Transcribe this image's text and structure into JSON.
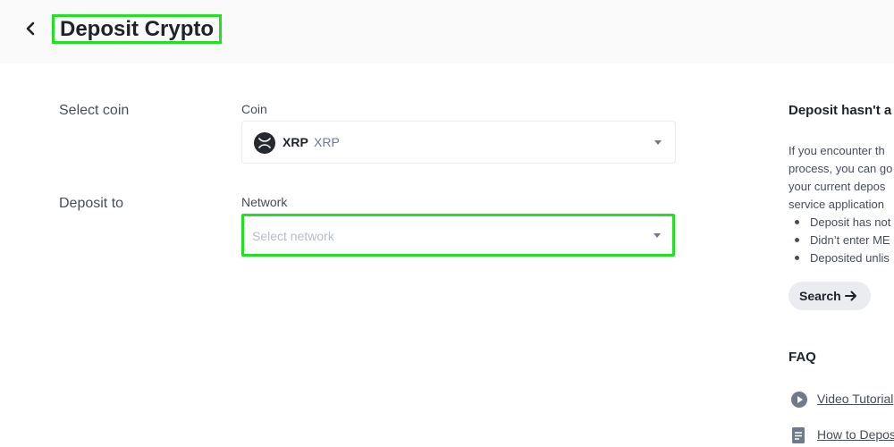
{
  "header": {
    "title": "Deposit Crypto"
  },
  "form": {
    "select_coin_label": "Select coin",
    "coin_caption": "Coin",
    "coin": {
      "symbol": "XRP",
      "name": "XRP"
    },
    "deposit_to_label": "Deposit to",
    "network_caption": "Network",
    "network_placeholder": "Select network"
  },
  "sidebar": {
    "title": "Deposit hasn't a",
    "lines": [
      "If you encounter th",
      "process, you can go",
      "your current depos",
      "service application"
    ],
    "bullets": [
      "Deposit has not",
      "Didn’t enter ME",
      "Deposited unlis"
    ],
    "search_label": "Search",
    "faq_title": "FAQ",
    "faq_links": [
      "Video Tutorial",
      "How to Depos"
    ]
  },
  "colors": {
    "highlight": "#22e022",
    "text_primary": "#1e2329",
    "text_secondary": "#474d57"
  }
}
